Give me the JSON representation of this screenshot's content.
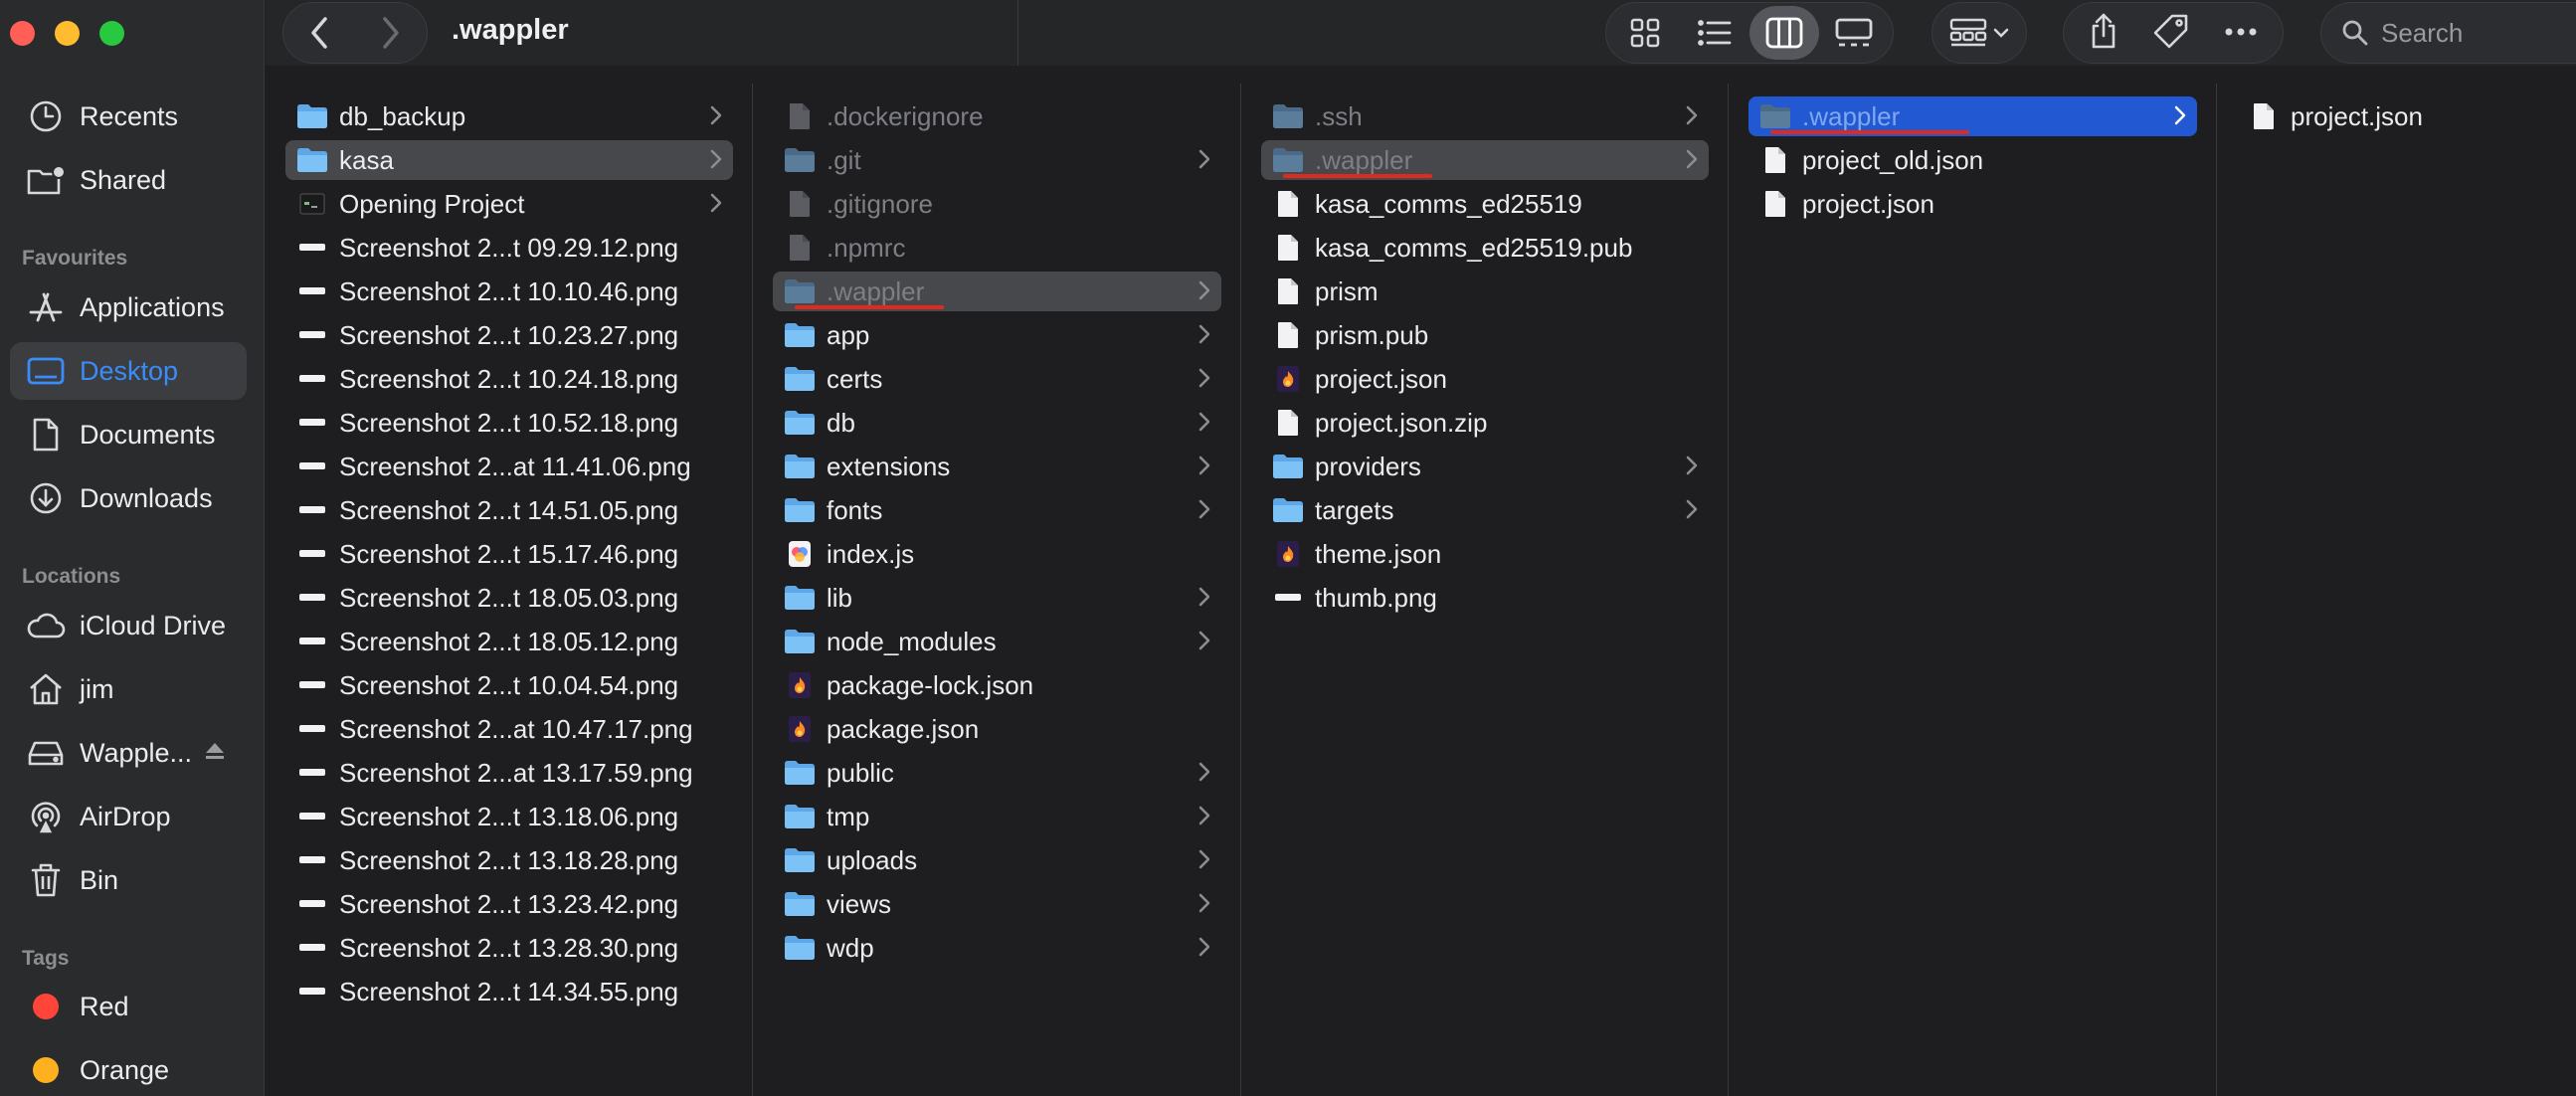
{
  "window": {
    "title": ".wappler",
    "colors": {
      "accent": "#3a8df8",
      "selection_blue": "#2259d2",
      "selection_gray": "#46484c",
      "annotation": "#e02a20"
    }
  },
  "toolbar": {
    "back_icon": "chevron-left-icon",
    "forward_icon": "chevron-right-icon",
    "view_icons": [
      "icon-view-icon",
      "list-view-icon",
      "column-view-icon",
      "gallery-view-icon"
    ],
    "active_view": "column-view-icon",
    "search": {
      "placeholder": "Search"
    }
  },
  "sidebar": {
    "top_items": [
      {
        "label": "Recents",
        "icon": "clock-icon"
      },
      {
        "label": "Shared",
        "icon": "shared-folder-icon"
      }
    ],
    "favourites_header": "Favourites",
    "favourites": [
      {
        "label": "Applications",
        "icon": "applications-icon"
      },
      {
        "label": "Desktop",
        "icon": "desktop-icon",
        "selected": true
      },
      {
        "label": "Documents",
        "icon": "document-icon"
      },
      {
        "label": "Downloads",
        "icon": "download-icon"
      }
    ],
    "locations_header": "Locations",
    "locations": [
      {
        "label": "iCloud Drive",
        "icon": "cloud-icon"
      },
      {
        "label": "jim",
        "icon": "home-icon"
      },
      {
        "label": "Wapple...",
        "icon": "drive-icon",
        "eject": true
      },
      {
        "label": "AirDrop",
        "icon": "airdrop-icon"
      },
      {
        "label": "Bin",
        "icon": "trash-icon"
      }
    ],
    "tags_header": "Tags",
    "tags": [
      {
        "label": "Red",
        "color": "#ff453a"
      },
      {
        "label": "Orange",
        "color": "#ffb01f"
      }
    ]
  },
  "columns": [
    {
      "items": [
        {
          "name": "db_backup",
          "icon": "folder-icon",
          "folder": true
        },
        {
          "name": "kasa",
          "icon": "folder-icon",
          "folder": true,
          "selected": "gray"
        },
        {
          "name": "Opening Project",
          "icon": "thumbnail-icon",
          "folder": true
        },
        {
          "name": "Screenshot 2...t 09.29.12.png",
          "icon": "image-thumbnail-icon"
        },
        {
          "name": "Screenshot 2...t 10.10.46.png",
          "icon": "image-thumbnail-icon"
        },
        {
          "name": "Screenshot 2...t 10.23.27.png",
          "icon": "image-thumbnail-icon"
        },
        {
          "name": "Screenshot 2...t 10.24.18.png",
          "icon": "image-thumbnail-icon"
        },
        {
          "name": "Screenshot 2...t 10.52.18.png",
          "icon": "image-thumbnail-icon"
        },
        {
          "name": "Screenshot 2...at 11.41.06.png",
          "icon": "image-thumbnail-icon"
        },
        {
          "name": "Screenshot 2...t 14.51.05.png",
          "icon": "image-thumbnail-icon"
        },
        {
          "name": "Screenshot 2...t 15.17.46.png",
          "icon": "image-thumbnail-icon"
        },
        {
          "name": "Screenshot 2...t 18.05.03.png",
          "icon": "image-thumbnail-icon"
        },
        {
          "name": "Screenshot 2...t 18.05.12.png",
          "icon": "image-thumbnail-icon"
        },
        {
          "name": "Screenshot 2...t 10.04.54.png",
          "icon": "image-thumbnail-icon"
        },
        {
          "name": "Screenshot 2...at 10.47.17.png",
          "icon": "image-thumbnail-icon"
        },
        {
          "name": "Screenshot 2...at 13.17.59.png",
          "icon": "image-thumbnail-icon"
        },
        {
          "name": "Screenshot 2...t 13.18.06.png",
          "icon": "image-thumbnail-icon"
        },
        {
          "name": "Screenshot 2...t 13.18.28.png",
          "icon": "image-thumbnail-icon"
        },
        {
          "name": "Screenshot 2...t 13.23.42.png",
          "icon": "image-thumbnail-icon"
        },
        {
          "name": "Screenshot 2...t 13.28.30.png",
          "icon": "image-thumbnail-icon"
        },
        {
          "name": "Screenshot 2...t 14.34.55.png",
          "icon": "image-thumbnail-icon"
        }
      ]
    },
    {
      "items": [
        {
          "name": ".dockerignore",
          "icon": "file-icon",
          "dim": true
        },
        {
          "name": ".git",
          "icon": "folder-icon",
          "folder": true,
          "dim": true
        },
        {
          "name": ".gitignore",
          "icon": "file-icon",
          "dim": true
        },
        {
          "name": ".npmrc",
          "icon": "file-icon",
          "dim": true
        },
        {
          "name": ".wappler",
          "icon": "folder-icon",
          "folder": true,
          "dim": true,
          "selected": "gray",
          "annotated": true
        },
        {
          "name": "app",
          "icon": "folder-icon",
          "folder": true
        },
        {
          "name": "certs",
          "icon": "folder-icon",
          "folder": true
        },
        {
          "name": "db",
          "icon": "folder-icon",
          "folder": true
        },
        {
          "name": "extensions",
          "icon": "folder-icon",
          "folder": true
        },
        {
          "name": "fonts",
          "icon": "folder-icon",
          "folder": true
        },
        {
          "name": "index.js",
          "icon": "js-file-icon"
        },
        {
          "name": "lib",
          "icon": "folder-icon",
          "folder": true
        },
        {
          "name": "node_modules",
          "icon": "folder-icon",
          "folder": true
        },
        {
          "name": "package-lock.json",
          "icon": "json-file-icon"
        },
        {
          "name": "package.json",
          "icon": "json-file-icon"
        },
        {
          "name": "public",
          "icon": "folder-icon",
          "folder": true
        },
        {
          "name": "tmp",
          "icon": "folder-icon",
          "folder": true
        },
        {
          "name": "uploads",
          "icon": "folder-icon",
          "folder": true
        },
        {
          "name": "views",
          "icon": "folder-icon",
          "folder": true
        },
        {
          "name": "wdp",
          "icon": "folder-icon",
          "folder": true
        }
      ]
    },
    {
      "items": [
        {
          "name": ".ssh",
          "icon": "folder-icon",
          "folder": true,
          "dim": true
        },
        {
          "name": ".wappler",
          "icon": "folder-icon",
          "folder": true,
          "dim": true,
          "selected": "gray",
          "annotated": true
        },
        {
          "name": "kasa_comms_ed25519",
          "icon": "file-icon"
        },
        {
          "name": "kasa_comms_ed25519.pub",
          "icon": "file-icon"
        },
        {
          "name": "prism",
          "icon": "file-icon"
        },
        {
          "name": "prism.pub",
          "icon": "file-icon"
        },
        {
          "name": "project.json",
          "icon": "json-file-icon"
        },
        {
          "name": "project.json.zip",
          "icon": "file-icon"
        },
        {
          "name": "providers",
          "icon": "folder-icon",
          "folder": true
        },
        {
          "name": "targets",
          "icon": "folder-icon",
          "folder": true
        },
        {
          "name": "theme.json",
          "icon": "json-file-icon"
        },
        {
          "name": "thumb.png",
          "icon": "image-thumbnail-icon"
        }
      ]
    },
    {
      "items": [
        {
          "name": ".wappler",
          "icon": "folder-icon",
          "folder": true,
          "dim": true,
          "selected": "blue",
          "annotated": true
        },
        {
          "name": "project_old.json",
          "icon": "file-icon"
        },
        {
          "name": "project.json",
          "icon": "file-icon"
        }
      ]
    },
    {
      "items": [
        {
          "name": "project.json",
          "icon": "file-icon"
        }
      ]
    }
  ]
}
